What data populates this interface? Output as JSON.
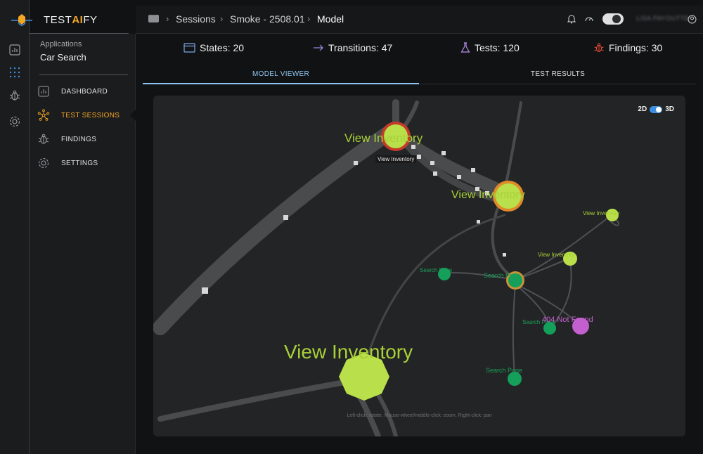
{
  "brand": {
    "prefix": "TEST",
    "accent": "AI",
    "suffix": "FY"
  },
  "sidebar": {
    "section_label": "Applications",
    "app_name": "Car Search",
    "items": [
      {
        "label": "DASHBOARD",
        "icon": "chart-icon",
        "active": false
      },
      {
        "label": "TEST SESSIONS",
        "icon": "network-icon",
        "active": true
      },
      {
        "label": "FINDINGS",
        "icon": "bug-icon",
        "active": false
      },
      {
        "label": "SETTINGS",
        "icon": "gear-icon",
        "active": false
      }
    ]
  },
  "breadcrumb": [
    "Sessions",
    "Smoke - 2508.01",
    "Model"
  ],
  "header": {
    "user_name": "LISA PAYOUTTE"
  },
  "stats": {
    "states": "States: 20",
    "transitions": "Transitions: 47",
    "tests": "Tests: 120",
    "findings": "Findings: 30"
  },
  "tabs": {
    "model_viewer": "MODEL VIEWER",
    "test_results": "TEST RESULTS"
  },
  "viewer": {
    "dim_2d": "2D",
    "dim_3d": "3D",
    "tooltip": "View Inventory",
    "hint": "Left-click: rotate, Mouse-wheel/middle-click: zoom, Right-click: pan",
    "node_labels": {
      "big": "View Inventory",
      "top": "View Inventory",
      "mid": "View Inventory",
      "right_top": "View Inventory",
      "right_mid": "View Inventory",
      "search_1": "Search Page",
      "search_2": "Search Page",
      "search_3": "Search Page",
      "search_4": "Search Page",
      "not_found": "404 Not Found"
    }
  },
  "colors": {
    "accent": "#f5a623",
    "active_tab": "#8ec5f0",
    "node_lime": "#b9e04a",
    "node_green": "#14a05a",
    "node_magenta": "#c45fd0",
    "findings_red": "#e04a3a"
  }
}
